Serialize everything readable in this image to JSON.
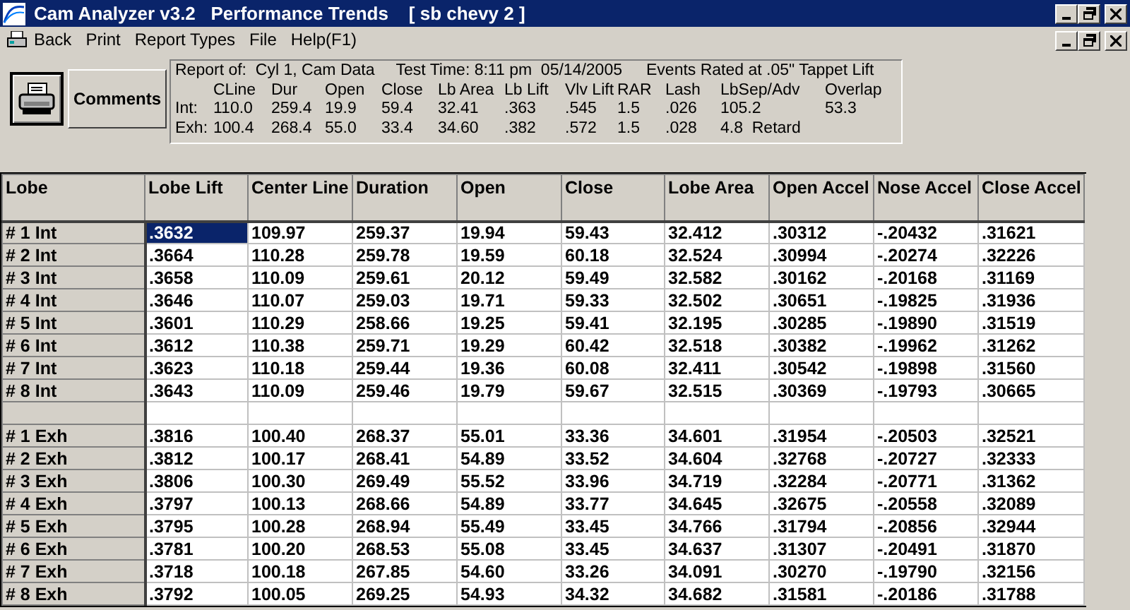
{
  "window": {
    "title": "Cam Analyzer v3.2   Performance Trends    [ sb chevy 2 ]"
  },
  "menu": [
    "Back",
    "Print",
    "Report Types",
    "File",
    "Help(F1)"
  ],
  "toolbar": {
    "comments_button": "Comments"
  },
  "report": {
    "report_of": "Report of:  Cyl 1, Cam Data",
    "test_time": "Test Time: 8:11 pm  05/14/2005",
    "events_rated": "Events Rated at .05\" Tappet Lift",
    "columns": [
      "CLine",
      "Dur",
      "Open",
      "Close",
      "Lb Area",
      "Lb Lift",
      "Vlv Lift",
      "RAR",
      "Lash",
      "LbSep/Adv",
      "Overlap"
    ],
    "rows": [
      {
        "label": "Int:",
        "values": [
          "110.0",
          "259.4",
          "19.9",
          "59.4",
          "32.41",
          ".363",
          ".545",
          "1.5",
          ".026",
          "105.2",
          "53.3"
        ]
      },
      {
        "label": "Exh:",
        "values": [
          "100.4",
          "268.4",
          "55.0",
          "33.4",
          "34.60",
          ".382",
          ".572",
          "1.5",
          ".028",
          "4.8  Retard"
        ]
      }
    ]
  },
  "table": {
    "columns": [
      "Lobe",
      "Lobe Lift",
      "Center Line",
      "Duration",
      "Open",
      "Close",
      "Lobe Area",
      "Open Accel",
      "Nose Accel",
      "Close Accel"
    ],
    "rows": [
      {
        "kind": "data",
        "lobe": "# 1 Int",
        "cells": [
          {
            "text": ".3632",
            "selected": true
          },
          {
            "text": "109.97",
            "selected": false
          },
          {
            "text": "259.37",
            "selected": false
          },
          {
            "text": "19.94",
            "selected": false
          },
          {
            "text": "59.43",
            "selected": false
          },
          {
            "text": "32.412",
            "selected": false
          },
          {
            "text": ".30312",
            "selected": false
          },
          {
            "text": "-.20432",
            "selected": false
          },
          {
            "text": ".31621",
            "selected": false
          }
        ]
      },
      {
        "kind": "data",
        "lobe": "# 2 Int",
        "cells": [
          {
            "text": ".3664",
            "selected": false
          },
          {
            "text": "110.28",
            "selected": false
          },
          {
            "text": "259.78",
            "selected": false
          },
          {
            "text": "19.59",
            "selected": false
          },
          {
            "text": "60.18",
            "selected": false
          },
          {
            "text": "32.524",
            "selected": false
          },
          {
            "text": ".30994",
            "selected": false
          },
          {
            "text": "-.20274",
            "selected": false
          },
          {
            "text": ".32226",
            "selected": false
          }
        ]
      },
      {
        "kind": "data",
        "lobe": "# 3 Int",
        "cells": [
          {
            "text": ".3658",
            "selected": false
          },
          {
            "text": "110.09",
            "selected": false
          },
          {
            "text": "259.61",
            "selected": false
          },
          {
            "text": "20.12",
            "selected": false
          },
          {
            "text": "59.49",
            "selected": false
          },
          {
            "text": "32.582",
            "selected": false
          },
          {
            "text": ".30162",
            "selected": false
          },
          {
            "text": "-.20168",
            "selected": false
          },
          {
            "text": ".31169",
            "selected": false
          }
        ]
      },
      {
        "kind": "data",
        "lobe": "# 4 Int",
        "cells": [
          {
            "text": ".3646",
            "selected": false
          },
          {
            "text": "110.07",
            "selected": false
          },
          {
            "text": "259.03",
            "selected": false
          },
          {
            "text": "19.71",
            "selected": false
          },
          {
            "text": "59.33",
            "selected": false
          },
          {
            "text": "32.502",
            "selected": false
          },
          {
            "text": ".30651",
            "selected": false
          },
          {
            "text": "-.19825",
            "selected": false
          },
          {
            "text": ".31936",
            "selected": false
          }
        ]
      },
      {
        "kind": "data",
        "lobe": "# 5 Int",
        "cells": [
          {
            "text": ".3601",
            "selected": false
          },
          {
            "text": "110.29",
            "selected": false
          },
          {
            "text": "258.66",
            "selected": false
          },
          {
            "text": "19.25",
            "selected": false
          },
          {
            "text": "59.41",
            "selected": false
          },
          {
            "text": "32.195",
            "selected": false
          },
          {
            "text": ".30285",
            "selected": false
          },
          {
            "text": "-.19890",
            "selected": false
          },
          {
            "text": ".31519",
            "selected": false
          }
        ]
      },
      {
        "kind": "data",
        "lobe": "# 6 Int",
        "cells": [
          {
            "text": ".3612",
            "selected": false
          },
          {
            "text": "110.38",
            "selected": false
          },
          {
            "text": "259.71",
            "selected": false
          },
          {
            "text": "19.29",
            "selected": false
          },
          {
            "text": "60.42",
            "selected": false
          },
          {
            "text": "32.518",
            "selected": false
          },
          {
            "text": ".30382",
            "selected": false
          },
          {
            "text": "-.19962",
            "selected": false
          },
          {
            "text": ".31262",
            "selected": false
          }
        ]
      },
      {
        "kind": "data",
        "lobe": "# 7 Int",
        "cells": [
          {
            "text": ".3623",
            "selected": false
          },
          {
            "text": "110.18",
            "selected": false
          },
          {
            "text": "259.44",
            "selected": false
          },
          {
            "text": "19.36",
            "selected": false
          },
          {
            "text": "60.08",
            "selected": false
          },
          {
            "text": "32.411",
            "selected": false
          },
          {
            "text": ".30542",
            "selected": false
          },
          {
            "text": "-.19898",
            "selected": false
          },
          {
            "text": ".31560",
            "selected": false
          }
        ]
      },
      {
        "kind": "data",
        "lobe": "# 8 Int",
        "cells": [
          {
            "text": ".3643",
            "selected": false
          },
          {
            "text": "110.09",
            "selected": false
          },
          {
            "text": "259.46",
            "selected": false
          },
          {
            "text": "19.79",
            "selected": false
          },
          {
            "text": "59.67",
            "selected": false
          },
          {
            "text": "32.515",
            "selected": false
          },
          {
            "text": ".30369",
            "selected": false
          },
          {
            "text": "-.19793",
            "selected": false
          },
          {
            "text": ".30665",
            "selected": false
          }
        ]
      },
      {
        "kind": "blank"
      },
      {
        "kind": "data",
        "lobe": "# 1 Exh",
        "cells": [
          {
            "text": ".3816",
            "selected": false
          },
          {
            "text": "100.40",
            "selected": false
          },
          {
            "text": "268.37",
            "selected": false
          },
          {
            "text": "55.01",
            "selected": false
          },
          {
            "text": "33.36",
            "selected": false
          },
          {
            "text": "34.601",
            "selected": false
          },
          {
            "text": ".31954",
            "selected": false
          },
          {
            "text": "-.20503",
            "selected": false
          },
          {
            "text": ".32521",
            "selected": false
          }
        ]
      },
      {
        "kind": "data",
        "lobe": "# 2 Exh",
        "cells": [
          {
            "text": ".3812",
            "selected": false
          },
          {
            "text": "100.17",
            "selected": false
          },
          {
            "text": "268.41",
            "selected": false
          },
          {
            "text": "54.89",
            "selected": false
          },
          {
            "text": "33.52",
            "selected": false
          },
          {
            "text": "34.604",
            "selected": false
          },
          {
            "text": ".32768",
            "selected": false
          },
          {
            "text": "-.20727",
            "selected": false
          },
          {
            "text": ".32333",
            "selected": false
          }
        ]
      },
      {
        "kind": "data",
        "lobe": "# 3 Exh",
        "cells": [
          {
            "text": ".3806",
            "selected": false
          },
          {
            "text": "100.30",
            "selected": false
          },
          {
            "text": "269.49",
            "selected": false
          },
          {
            "text": "55.52",
            "selected": false
          },
          {
            "text": "33.96",
            "selected": false
          },
          {
            "text": "34.719",
            "selected": false
          },
          {
            "text": ".32284",
            "selected": false
          },
          {
            "text": "-.20771",
            "selected": false
          },
          {
            "text": ".31362",
            "selected": false
          }
        ]
      },
      {
        "kind": "data",
        "lobe": "# 4 Exh",
        "cells": [
          {
            "text": ".3797",
            "selected": false
          },
          {
            "text": "100.13",
            "selected": false
          },
          {
            "text": "268.66",
            "selected": false
          },
          {
            "text": "54.89",
            "selected": false
          },
          {
            "text": "33.77",
            "selected": false
          },
          {
            "text": "34.645",
            "selected": false
          },
          {
            "text": ".32675",
            "selected": false
          },
          {
            "text": "-.20558",
            "selected": false
          },
          {
            "text": ".32089",
            "selected": false
          }
        ]
      },
      {
        "kind": "data",
        "lobe": "# 5 Exh",
        "cells": [
          {
            "text": ".3795",
            "selected": false
          },
          {
            "text": "100.28",
            "selected": false
          },
          {
            "text": "268.94",
            "selected": false
          },
          {
            "text": "55.49",
            "selected": false
          },
          {
            "text": "33.45",
            "selected": false
          },
          {
            "text": "34.766",
            "selected": false
          },
          {
            "text": ".31794",
            "selected": false
          },
          {
            "text": "-.20856",
            "selected": false
          },
          {
            "text": ".32944",
            "selected": false
          }
        ]
      },
      {
        "kind": "data",
        "lobe": "# 6 Exh",
        "cells": [
          {
            "text": ".3781",
            "selected": false
          },
          {
            "text": "100.20",
            "selected": false
          },
          {
            "text": "268.53",
            "selected": false
          },
          {
            "text": "55.08",
            "selected": false
          },
          {
            "text": "33.45",
            "selected": false
          },
          {
            "text": "34.637",
            "selected": false
          },
          {
            "text": ".31307",
            "selected": false
          },
          {
            "text": "-.20491",
            "selected": false
          },
          {
            "text": ".31870",
            "selected": false
          }
        ]
      },
      {
        "kind": "data",
        "lobe": "# 7 Exh",
        "cells": [
          {
            "text": ".3718",
            "selected": false
          },
          {
            "text": "100.18",
            "selected": false
          },
          {
            "text": "267.85",
            "selected": false
          },
          {
            "text": "54.60",
            "selected": false
          },
          {
            "text": "33.26",
            "selected": false
          },
          {
            "text": "34.091",
            "selected": false
          },
          {
            "text": ".30270",
            "selected": false
          },
          {
            "text": "-.19790",
            "selected": false
          },
          {
            "text": ".32156",
            "selected": false
          }
        ]
      },
      {
        "kind": "data",
        "lobe": "# 8 Exh",
        "cells": [
          {
            "text": ".3792",
            "selected": false
          },
          {
            "text": "100.05",
            "selected": false
          },
          {
            "text": "269.25",
            "selected": false
          },
          {
            "text": "54.93",
            "selected": false
          },
          {
            "text": "34.32",
            "selected": false
          },
          {
            "text": "34.682",
            "selected": false
          },
          {
            "text": ".31581",
            "selected": false
          },
          {
            "text": "-.20186",
            "selected": false
          },
          {
            "text": ".31788",
            "selected": false
          }
        ]
      }
    ]
  }
}
